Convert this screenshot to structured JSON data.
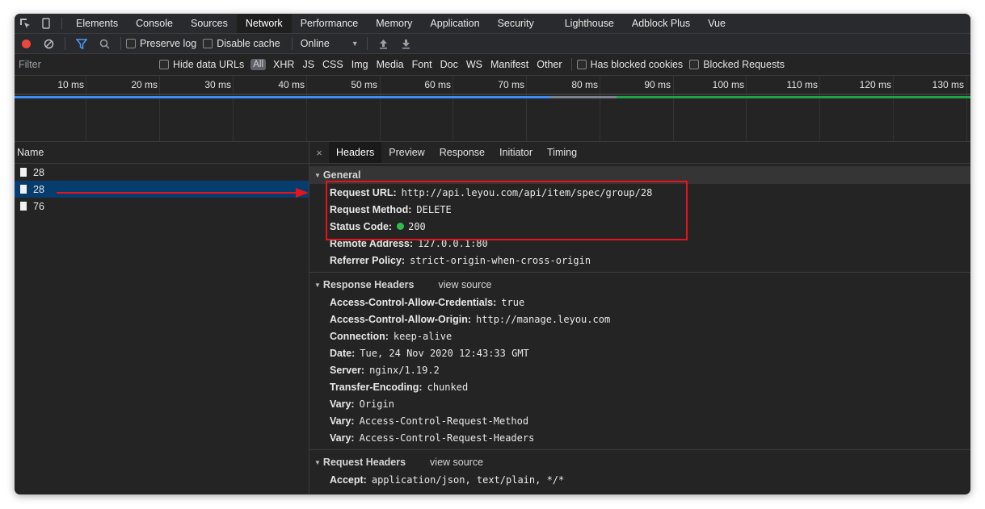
{
  "tabs": [
    "Elements",
    "Console",
    "Sources",
    "Network",
    "Performance",
    "Memory",
    "Application",
    "Security",
    "Lighthouse",
    "Adblock Plus",
    "Vue"
  ],
  "active_tab": "Network",
  "toolbar": {
    "preserve_log": "Preserve log",
    "disable_cache": "Disable cache",
    "throttle": "Online"
  },
  "filter": {
    "placeholder": "Filter",
    "hide_data_urls": "Hide data URLs",
    "all": "All",
    "types": [
      "XHR",
      "JS",
      "CSS",
      "Img",
      "Media",
      "Font",
      "Doc",
      "WS",
      "Manifest",
      "Other"
    ],
    "has_blocked_cookies": "Has blocked cookies",
    "blocked_requests": "Blocked Requests"
  },
  "timeline": {
    "ticks": [
      "10 ms",
      "20 ms",
      "30 ms",
      "40 ms",
      "50 ms",
      "60 ms",
      "70 ms",
      "80 ms",
      "90 ms",
      "100 ms",
      "110 ms",
      "120 ms",
      "130 ms"
    ]
  },
  "requests": {
    "header": "Name",
    "rows": [
      "28",
      "28",
      "76"
    ],
    "selected_index": 1
  },
  "detail": {
    "tabs": [
      "Headers",
      "Preview",
      "Response",
      "Initiator",
      "Timing"
    ],
    "active_tab": "Headers",
    "close": "×",
    "general": {
      "title": "General",
      "rows": [
        {
          "k": "Request URL:",
          "v": "http://api.leyou.com/api/item/spec/group/28"
        },
        {
          "k": "Request Method:",
          "v": "DELETE"
        },
        {
          "k": "Status Code:",
          "v": "200"
        },
        {
          "k": "Remote Address:",
          "v": "127.0.0.1:80"
        },
        {
          "k": "Referrer Policy:",
          "v": "strict-origin-when-cross-origin"
        }
      ]
    },
    "response_headers": {
      "title": "Response Headers",
      "view_source": "view source",
      "rows": [
        {
          "k": "Access-Control-Allow-Credentials:",
          "v": "true"
        },
        {
          "k": "Access-Control-Allow-Origin:",
          "v": "http://manage.leyou.com"
        },
        {
          "k": "Connection:",
          "v": "keep-alive"
        },
        {
          "k": "Date:",
          "v": "Tue, 24 Nov 2020 12:43:33 GMT"
        },
        {
          "k": "Server:",
          "v": "nginx/1.19.2"
        },
        {
          "k": "Transfer-Encoding:",
          "v": "chunked"
        },
        {
          "k": "Vary:",
          "v": "Origin"
        },
        {
          "k": "Vary:",
          "v": "Access-Control-Request-Method"
        },
        {
          "k": "Vary:",
          "v": "Access-Control-Request-Headers"
        }
      ]
    },
    "request_headers": {
      "title": "Request Headers",
      "view_source": "view source",
      "rows": [
        {
          "k": "Accept:",
          "v": "application/json, text/plain, */*"
        }
      ]
    }
  },
  "colors": {
    "record": "#f0463a",
    "selected_row": "#073d6e",
    "status_ok": "#2dbd4e",
    "annotation": "#e8131c"
  }
}
